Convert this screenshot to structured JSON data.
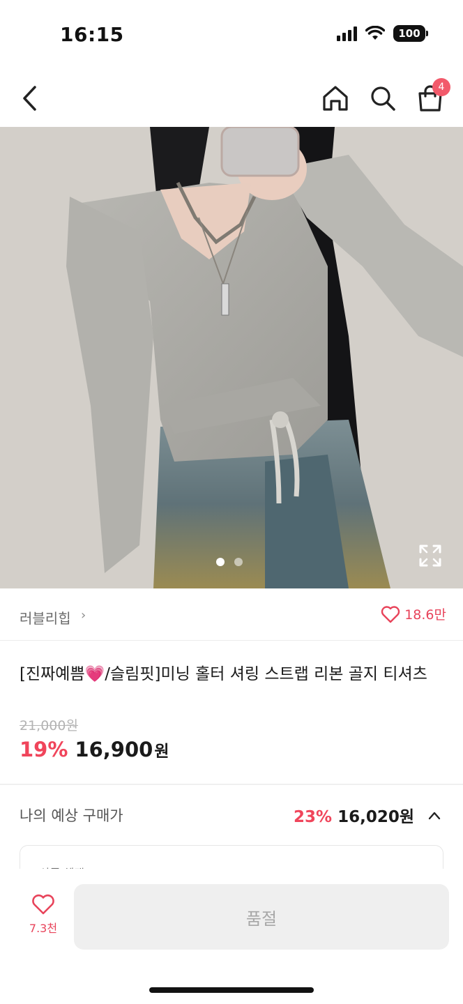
{
  "status_bar": {
    "time": "16:15",
    "battery": "100"
  },
  "header": {
    "cart_count": "4"
  },
  "hero": {
    "slide_count": 2,
    "active_slide": 1
  },
  "seller": {
    "name": "러블리힙",
    "chevron": "›",
    "like_count": "18.6만"
  },
  "product": {
    "title": "[진짜예쁨💗/슬림핏]미닝 홀터 셔링 스트랩 리본 골지 티셔츠",
    "original_price": "21,000원",
    "discount": "19%",
    "price": "16,900",
    "price_unit": "원"
  },
  "expected": {
    "label": "나의 예상 구매가",
    "discount": "23%",
    "price": "16,020원"
  },
  "info_card": {
    "label": "상품 혜택"
  },
  "bottom": {
    "wish_count": "7.3천",
    "buy_label": "품절"
  },
  "colors": {
    "accent": "#f0455b",
    "badge": "#f25a6b",
    "disabled_bg": "#efefef"
  }
}
